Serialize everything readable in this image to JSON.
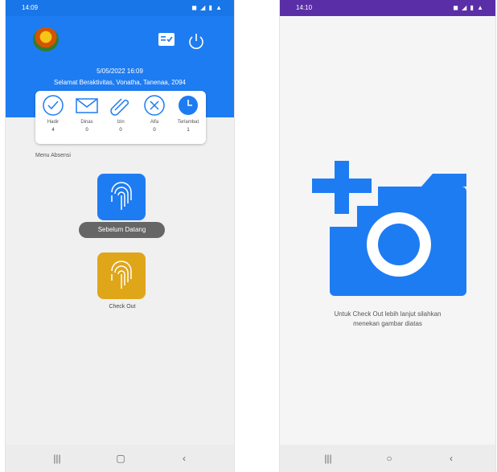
{
  "left": {
    "status": {
      "time": "14:09",
      "icons": "◼ ◢ ▮ ▲"
    },
    "header": {
      "datetime": "5/05/2022 16:09",
      "greeting": "Selamat Beraktivitas, Vonatha, Tanenaa, 2094"
    },
    "stats": [
      {
        "label": "Hadir",
        "value": "4",
        "icon": "check-circle-icon"
      },
      {
        "label": "Dinas",
        "value": "0",
        "icon": "envelope-icon"
      },
      {
        "label": "Izin",
        "value": "0",
        "icon": "paperclip-icon"
      },
      {
        "label": "Alfa",
        "value": "0",
        "icon": "x-circle-icon"
      },
      {
        "label": "Terlambat",
        "value": "1",
        "icon": "clock-icon"
      }
    ],
    "section_title": "Menu Absensi",
    "checkin_tooltip": "Sebelum Datang",
    "checkout_label": "Check Out"
  },
  "right": {
    "status": {
      "time": "14:10",
      "icons": "◼ ◢ ▮ ▲"
    },
    "message_line1": "Untuk Check Out lebih lanjut silahkan",
    "message_line2": "menekan gambar diatas"
  },
  "colors": {
    "primary": "#1e7cf2",
    "checkout": "#e0a61a",
    "status_right": "#5a2ea6"
  }
}
